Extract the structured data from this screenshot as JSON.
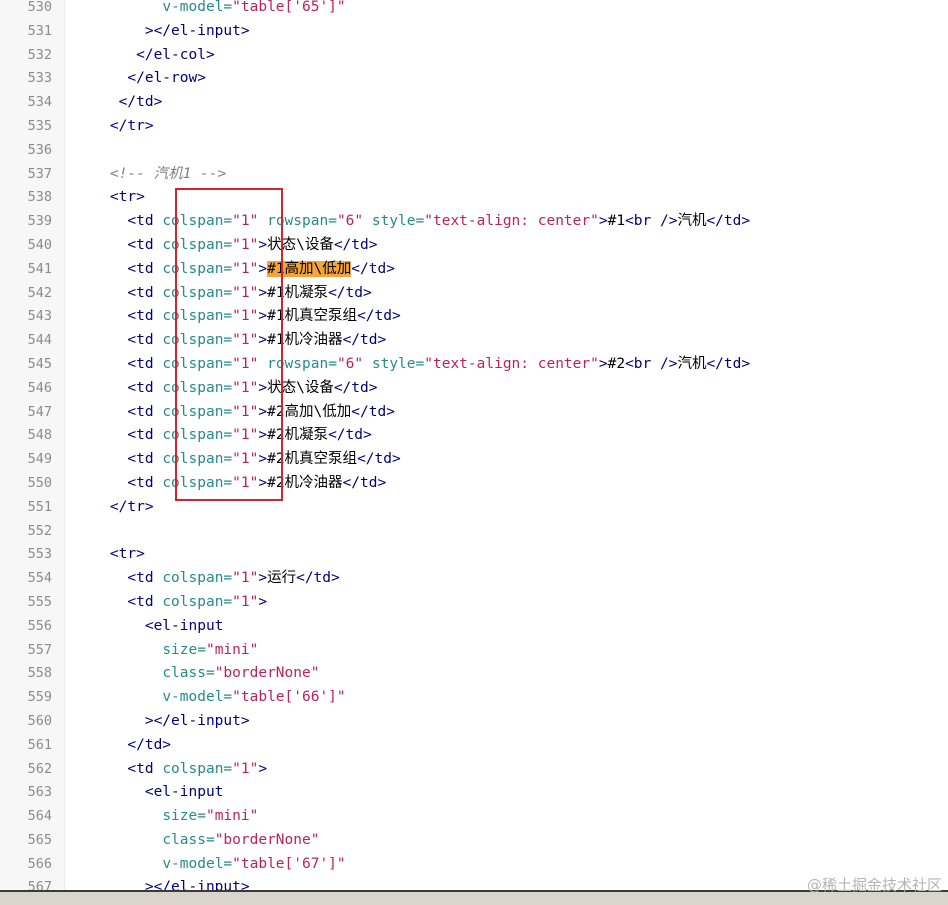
{
  "editor": {
    "lines": [
      {
        "n": "530",
        "segments": [
          {
            "t": "      ",
            "c": "txt"
          },
          {
            "t": "v-model=",
            "c": "attr"
          },
          {
            "t": "\"table['65']\"",
            "c": "str"
          }
        ]
      },
      {
        "n": "531",
        "segments": [
          {
            "t": "    ></el-input>",
            "c": "tag"
          }
        ]
      },
      {
        "n": "532",
        "segments": [
          {
            "t": "   </el-col>",
            "c": "tag"
          }
        ]
      },
      {
        "n": "533",
        "segments": [
          {
            "t": "  </el-row>",
            "c": "tag"
          }
        ]
      },
      {
        "n": "534",
        "segments": [
          {
            "t": " </td>",
            "c": "tag"
          }
        ]
      },
      {
        "n": "535",
        "segments": [
          {
            "t": "</tr>",
            "c": "tag"
          }
        ]
      },
      {
        "n": "536",
        "segments": []
      },
      {
        "n": "537",
        "segments": [
          {
            "t": "<!-- 汽机1 -->",
            "c": "cmt"
          }
        ]
      },
      {
        "n": "538",
        "segments": [
          {
            "t": "<tr>",
            "c": "tag"
          }
        ]
      },
      {
        "n": "539",
        "segments": [
          {
            "t": "  <td ",
            "c": "tag"
          },
          {
            "t": "colspan=",
            "c": "attr"
          },
          {
            "t": "\"1\"",
            "c": "str"
          },
          {
            "t": " rowspan=",
            "c": "attr"
          },
          {
            "t": "\"6\"",
            "c": "str"
          },
          {
            "t": " style=",
            "c": "attr"
          },
          {
            "t": "\"text-align: center\"",
            "c": "str"
          },
          {
            "t": ">",
            "c": "tag"
          },
          {
            "t": "#1",
            "c": "txt"
          },
          {
            "t": "<br />",
            "c": "tag"
          },
          {
            "t": "汽机",
            "c": "txt"
          },
          {
            "t": "</td>",
            "c": "tag"
          }
        ]
      },
      {
        "n": "540",
        "segments": [
          {
            "t": "  <td ",
            "c": "tag"
          },
          {
            "t": "colspan=",
            "c": "attr"
          },
          {
            "t": "\"1\"",
            "c": "str"
          },
          {
            "t": ">",
            "c": "tag"
          },
          {
            "t": "状态\\设备",
            "c": "txt"
          },
          {
            "t": "</td>",
            "c": "tag"
          }
        ]
      },
      {
        "n": "541",
        "segments": [
          {
            "t": "  <td ",
            "c": "tag"
          },
          {
            "t": "colspan=",
            "c": "attr"
          },
          {
            "t": "\"1\"",
            "c": "str"
          },
          {
            "t": ">",
            "c": "tag"
          },
          {
            "t": "#1高加\\低加",
            "c": "hl"
          },
          {
            "t": "</td>",
            "c": "tag"
          }
        ]
      },
      {
        "n": "542",
        "segments": [
          {
            "t": "  <td ",
            "c": "tag"
          },
          {
            "t": "colspan=",
            "c": "attr"
          },
          {
            "t": "\"1\"",
            "c": "str"
          },
          {
            "t": ">",
            "c": "tag"
          },
          {
            "t": "#1机凝泵",
            "c": "txt"
          },
          {
            "t": "</td>",
            "c": "tag"
          }
        ]
      },
      {
        "n": "543",
        "segments": [
          {
            "t": "  <td ",
            "c": "tag"
          },
          {
            "t": "colspan=",
            "c": "attr"
          },
          {
            "t": "\"1\"",
            "c": "str"
          },
          {
            "t": ">",
            "c": "tag"
          },
          {
            "t": "#1机真空泵组",
            "c": "txt"
          },
          {
            "t": "</td>",
            "c": "tag"
          }
        ]
      },
      {
        "n": "544",
        "segments": [
          {
            "t": "  <td ",
            "c": "tag"
          },
          {
            "t": "colspan=",
            "c": "attr"
          },
          {
            "t": "\"1\"",
            "c": "str"
          },
          {
            "t": ">",
            "c": "tag"
          },
          {
            "t": "#1机冷油器",
            "c": "txt"
          },
          {
            "t": "</td>",
            "c": "tag"
          }
        ]
      },
      {
        "n": "545",
        "segments": [
          {
            "t": "  <td ",
            "c": "tag"
          },
          {
            "t": "colspan=",
            "c": "attr"
          },
          {
            "t": "\"1\"",
            "c": "str"
          },
          {
            "t": " rowspan=",
            "c": "attr"
          },
          {
            "t": "\"6\"",
            "c": "str"
          },
          {
            "t": " style=",
            "c": "attr"
          },
          {
            "t": "\"text-align: center\"",
            "c": "str"
          },
          {
            "t": ">",
            "c": "tag"
          },
          {
            "t": "#2",
            "c": "txt"
          },
          {
            "t": "<br />",
            "c": "tag"
          },
          {
            "t": "汽机",
            "c": "txt"
          },
          {
            "t": "</td>",
            "c": "tag"
          }
        ]
      },
      {
        "n": "546",
        "segments": [
          {
            "t": "  <td ",
            "c": "tag"
          },
          {
            "t": "colspan=",
            "c": "attr"
          },
          {
            "t": "\"1\"",
            "c": "str"
          },
          {
            "t": ">",
            "c": "tag"
          },
          {
            "t": "状态\\设备",
            "c": "txt"
          },
          {
            "t": "</td>",
            "c": "tag"
          }
        ]
      },
      {
        "n": "547",
        "segments": [
          {
            "t": "  <td ",
            "c": "tag"
          },
          {
            "t": "colspan=",
            "c": "attr"
          },
          {
            "t": "\"1\"",
            "c": "str"
          },
          {
            "t": ">",
            "c": "tag"
          },
          {
            "t": "#2高加\\低加",
            "c": "txt"
          },
          {
            "t": "</td>",
            "c": "tag"
          }
        ]
      },
      {
        "n": "548",
        "segments": [
          {
            "t": "  <td ",
            "c": "tag"
          },
          {
            "t": "colspan=",
            "c": "attr"
          },
          {
            "t": "\"1\"",
            "c": "str"
          },
          {
            "t": ">",
            "c": "tag"
          },
          {
            "t": "#2机凝泵",
            "c": "txt"
          },
          {
            "t": "</td>",
            "c": "tag"
          }
        ]
      },
      {
        "n": "549",
        "segments": [
          {
            "t": "  <td ",
            "c": "tag"
          },
          {
            "t": "colspan=",
            "c": "attr"
          },
          {
            "t": "\"1\"",
            "c": "str"
          },
          {
            "t": ">",
            "c": "tag"
          },
          {
            "t": "#2机真空泵组",
            "c": "txt"
          },
          {
            "t": "</td>",
            "c": "tag"
          }
        ]
      },
      {
        "n": "550",
        "segments": [
          {
            "t": "  <td ",
            "c": "tag"
          },
          {
            "t": "colspan=",
            "c": "attr"
          },
          {
            "t": "\"1\"",
            "c": "str"
          },
          {
            "t": ">",
            "c": "tag"
          },
          {
            "t": "#2机冷油器",
            "c": "txt"
          },
          {
            "t": "</td>",
            "c": "tag"
          }
        ]
      },
      {
        "n": "551",
        "segments": [
          {
            "t": "</tr>",
            "c": "tag"
          }
        ]
      },
      {
        "n": "552",
        "segments": []
      },
      {
        "n": "553",
        "segments": [
          {
            "t": "<tr>",
            "c": "tag"
          }
        ]
      },
      {
        "n": "554",
        "segments": [
          {
            "t": "  <td ",
            "c": "tag"
          },
          {
            "t": "colspan=",
            "c": "attr"
          },
          {
            "t": "\"1\"",
            "c": "str"
          },
          {
            "t": ">",
            "c": "tag"
          },
          {
            "t": "运行",
            "c": "txt"
          },
          {
            "t": "</td>",
            "c": "tag"
          }
        ]
      },
      {
        "n": "555",
        "segments": [
          {
            "t": "  <td ",
            "c": "tag"
          },
          {
            "t": "colspan=",
            "c": "attr"
          },
          {
            "t": "\"1\"",
            "c": "str"
          },
          {
            "t": ">",
            "c": "tag"
          }
        ]
      },
      {
        "n": "556",
        "segments": [
          {
            "t": "    <el-input",
            "c": "tag"
          }
        ]
      },
      {
        "n": "557",
        "segments": [
          {
            "t": "      ",
            "c": "txt"
          },
          {
            "t": "size=",
            "c": "attr"
          },
          {
            "t": "\"mini\"",
            "c": "str"
          }
        ]
      },
      {
        "n": "558",
        "segments": [
          {
            "t": "      ",
            "c": "txt"
          },
          {
            "t": "class=",
            "c": "attr"
          },
          {
            "t": "\"borderNone\"",
            "c": "str"
          }
        ]
      },
      {
        "n": "559",
        "segments": [
          {
            "t": "      ",
            "c": "txt"
          },
          {
            "t": "v-model=",
            "c": "attr"
          },
          {
            "t": "\"table['66']\"",
            "c": "str"
          }
        ]
      },
      {
        "n": "560",
        "segments": [
          {
            "t": "    ></el-input>",
            "c": "tag"
          }
        ]
      },
      {
        "n": "561",
        "segments": [
          {
            "t": "  </td>",
            "c": "tag"
          }
        ]
      },
      {
        "n": "562",
        "segments": [
          {
            "t": "  <td ",
            "c": "tag"
          },
          {
            "t": "colspan=",
            "c": "attr"
          },
          {
            "t": "\"1\"",
            "c": "str"
          },
          {
            "t": ">",
            "c": "tag"
          }
        ]
      },
      {
        "n": "563",
        "segments": [
          {
            "t": "    <el-input",
            "c": "tag"
          }
        ]
      },
      {
        "n": "564",
        "segments": [
          {
            "t": "      ",
            "c": "txt"
          },
          {
            "t": "size=",
            "c": "attr"
          },
          {
            "t": "\"mini\"",
            "c": "str"
          }
        ]
      },
      {
        "n": "565",
        "segments": [
          {
            "t": "      ",
            "c": "txt"
          },
          {
            "t": "class=",
            "c": "attr"
          },
          {
            "t": "\"borderNone\"",
            "c": "str"
          }
        ]
      },
      {
        "n": "566",
        "segments": [
          {
            "t": "      ",
            "c": "txt"
          },
          {
            "t": "v-model=",
            "c": "attr"
          },
          {
            "t": "\"table['67']\"",
            "c": "str"
          }
        ]
      },
      {
        "n": "567",
        "segments": [
          {
            "t": "    ></el-input>",
            "c": "tag"
          }
        ]
      }
    ]
  },
  "watermark": "@稀土掘金技术社区",
  "colors": {
    "tag": "#000080",
    "attribute": "#268b8b",
    "string": "#c1205a",
    "comment": "#808080",
    "highlight": "#f5a43a",
    "annotation_box": "#d5232b"
  }
}
